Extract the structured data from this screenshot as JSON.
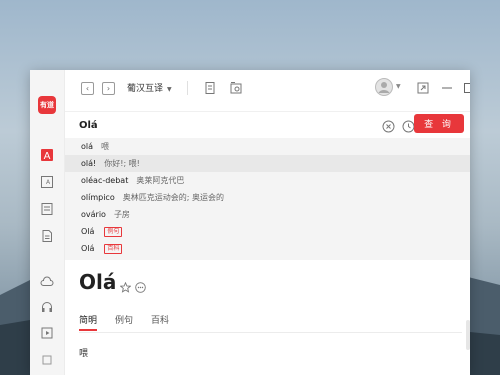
{
  "app": {
    "logo_text": "有道",
    "language_pair": "葡汉互译",
    "colors": {
      "accent": "#e8373b"
    }
  },
  "sidebar": {
    "items": [
      {
        "name": "translate-dict",
        "icon": "dict-icon",
        "active": true
      },
      {
        "name": "image-translate",
        "icon": "image-text-icon"
      },
      {
        "name": "wordbook",
        "icon": "book-icon"
      },
      {
        "name": "document",
        "icon": "document-icon"
      },
      {
        "name": "cloud",
        "icon": "cloud-icon"
      },
      {
        "name": "voice",
        "icon": "headset-icon"
      },
      {
        "name": "video",
        "icon": "video-icon"
      },
      {
        "name": "more",
        "icon": "square-icon"
      }
    ]
  },
  "search": {
    "value": "Olá",
    "button_label": "查 询"
  },
  "suggestions": [
    {
      "word": "olá",
      "def": "喂",
      "highlight": false
    },
    {
      "word": "olá!",
      "def": "你好!; 喂!",
      "highlight": true
    },
    {
      "word": "oléac-debat",
      "def": "奥莱阿克代巴",
      "highlight": false
    },
    {
      "word": "olímpico",
      "def": "奥林匹克运动会的; 奥运会的",
      "highlight": false
    },
    {
      "word": "ovário",
      "def": "子房",
      "highlight": false
    },
    {
      "word": "Olá",
      "def": "",
      "tag": "例句",
      "highlight": false
    },
    {
      "word": "Olá",
      "def": "",
      "tag": "百科",
      "highlight": false
    }
  ],
  "entry": {
    "headword": "Olá",
    "tabs": [
      "简明",
      "例句",
      "百科"
    ],
    "active_tab": "简明",
    "definition": "喂"
  }
}
